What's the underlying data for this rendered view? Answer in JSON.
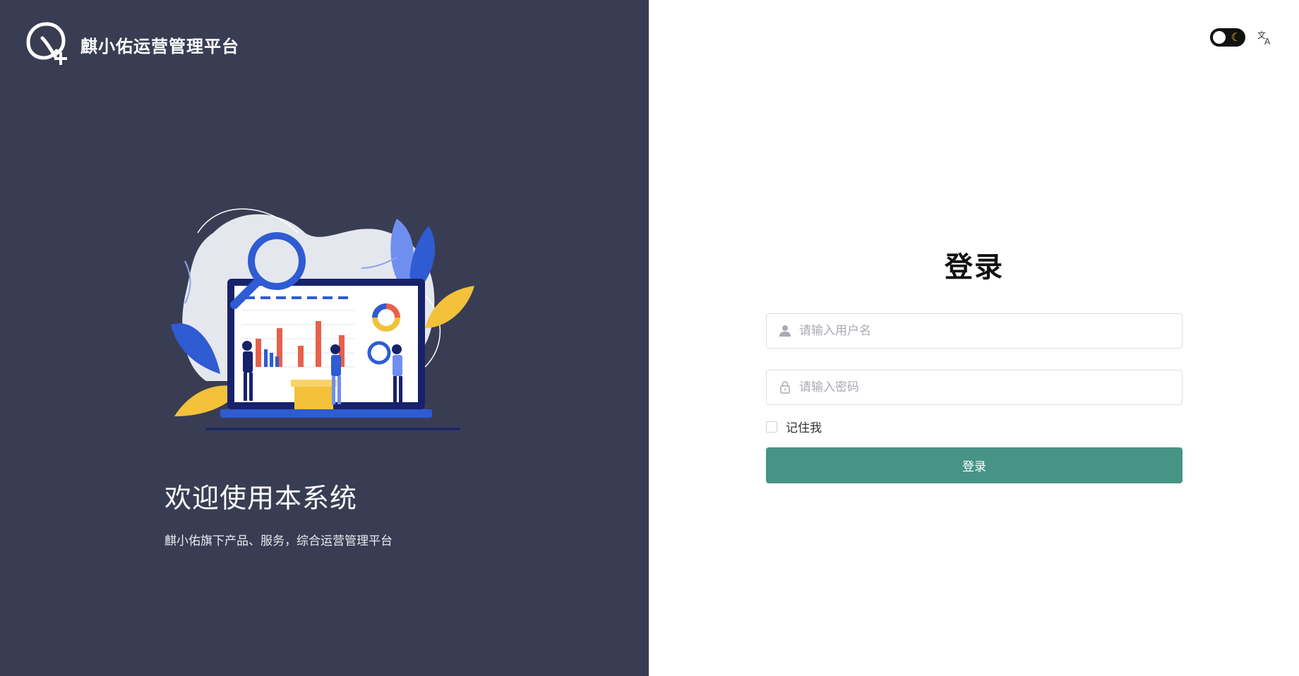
{
  "brand": {
    "title": "麒小佑运营管理平台",
    "logo_icon": "q-plus-logo-icon"
  },
  "welcome": {
    "title": "欢迎使用本系统",
    "subtitle": "麒小佑旗下产品、服务，综合运营管理平台"
  },
  "header": {
    "theme_toggle_icon": "moon-icon",
    "language_icon": "translate-icon"
  },
  "login": {
    "title": "登录",
    "username_placeholder": "请输入用户名",
    "password_placeholder": "请输入密码",
    "remember_label": "记住我",
    "submit_label": "登录"
  },
  "colors": {
    "left_background": "#393d53",
    "primary_button": "#479486",
    "accent_blue": "#2f5bd3",
    "accent_yellow": "#f3c13a"
  }
}
